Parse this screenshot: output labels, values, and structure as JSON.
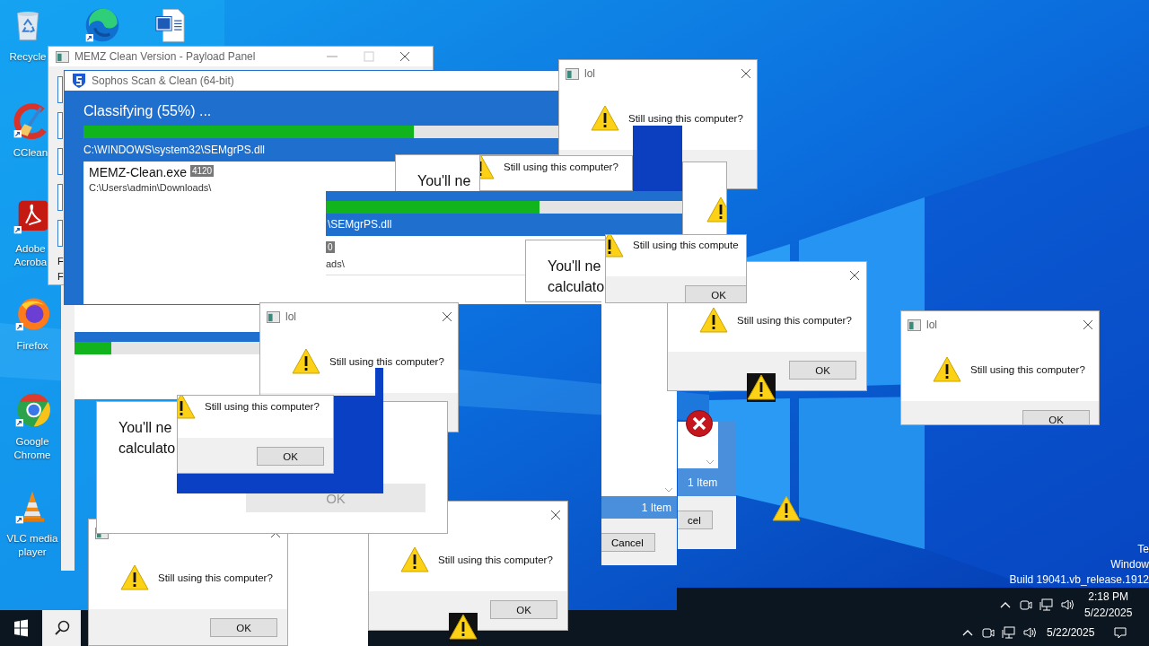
{
  "desktop_icons": [
    {
      "kind": "recycle",
      "label": [
        "Recycle"
      ]
    },
    {
      "kind": "edge"
    },
    {
      "kind": "word"
    },
    {
      "kind": "ccleaner",
      "label": [
        "CClean"
      ]
    },
    {
      "kind": "acrobat",
      "label": [
        "Adobe",
        "Acroba"
      ]
    },
    {
      "kind": "firefox",
      "label": [
        "Firefox"
      ]
    },
    {
      "kind": "chrome",
      "label": [
        "Google",
        "Chrome"
      ]
    },
    {
      "kind": "vlc",
      "label": [
        "VLC media",
        "player"
      ]
    }
  ],
  "windows": [
    {
      "kind": "panel",
      "title": "MEMZ Clean Version - Payload Panel",
      "fragments": [
        "F",
        "F"
      ]
    },
    {
      "kind": "sophos",
      "title": "Sophos Scan & Clean (64-bit)",
      "status": "Classifying (55%) ...",
      "level": 0.55,
      "path": "C:\\WINDOWS\\system32\\SEMgrPS.dll",
      "item": "MEMZ-Clean.exe",
      "badge": "4120",
      "folder": "C:\\Users\\admin\\Downloads\\"
    },
    {
      "kind": "calc",
      "lines": [
        "You'll ne"
      ]
    },
    {
      "kind": "msgbox",
      "title": "lol",
      "message": "Still using this computer?"
    },
    {
      "kind": "msgbox",
      "message": "Still using this computer?"
    },
    {
      "kind": "sophos_frag",
      "level": 0.59,
      "path": "\\SEMgrPS.dll",
      "badge": "0",
      "folder": "ads\\"
    },
    {
      "kind": "msgbox"
    },
    {
      "kind": "calc",
      "lines": [
        "You'll ne",
        "calculato"
      ]
    },
    {
      "kind": "list_frag",
      "status": "1 Item",
      "button": "Cancel"
    },
    {
      "kind": "list_frag",
      "status": "1 Item",
      "button": "cel"
    },
    {
      "kind": "msgbox",
      "message": "Still using this computer?",
      "button": "OK"
    },
    {
      "kind": "msgbox",
      "message": "Still using this compute",
      "button": "OK"
    },
    {
      "kind": "msgbox",
      "title": "lol",
      "message": "Still using this computer?",
      "button": "OK"
    },
    {
      "kind": "sophos_frag",
      "level": 0.2
    },
    {
      "kind": "msgbox",
      "message": "Still using this computer?",
      "button": "OK"
    },
    {
      "kind": "msgbox",
      "message": "Still using this computer?",
      "button": "OK"
    },
    {
      "kind": "msgbox",
      "title": "lol",
      "message": "Still using this computer?"
    },
    {
      "kind": "calc",
      "lines": [
        "You'll ne",
        "calculato"
      ],
      "button": "OK"
    },
    {
      "kind": "msgbox",
      "message": "Still using this computer?",
      "button": "OK"
    }
  ],
  "tray": [
    {
      "time": "2:18 PM",
      "date": "5/22/2025"
    },
    {
      "date": "5/22/2025"
    }
  ],
  "build_text": [
    "Te",
    "Window",
    "Build 19041.vb_release.1912"
  ]
}
